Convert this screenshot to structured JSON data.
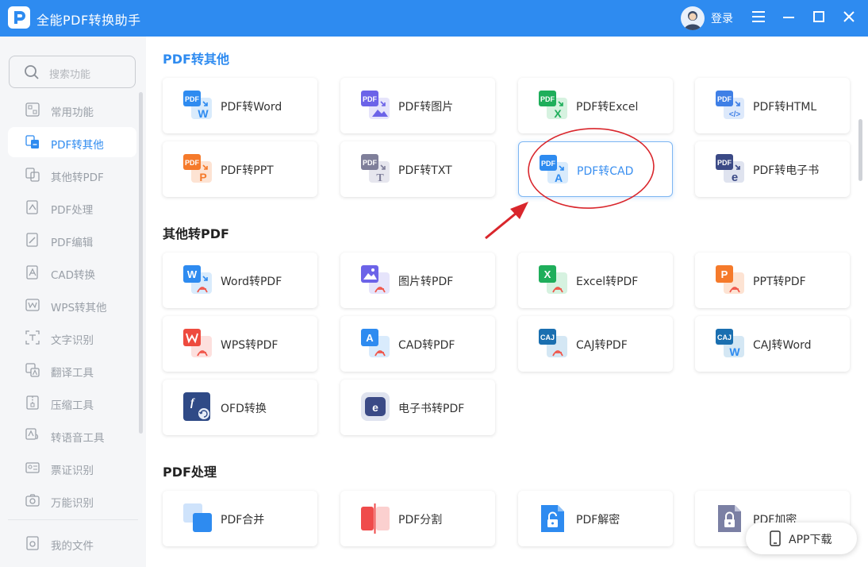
{
  "titlebar": {
    "app_title": "全能PDF转换助手",
    "login_label": "登录",
    "accent": "#2e8bf0"
  },
  "sidebar": {
    "search_placeholder": "搜索功能",
    "items": [
      {
        "label": "常用功能",
        "icon": "grid-icon",
        "active": false
      },
      {
        "label": "PDF转其他",
        "icon": "pdf-export-icon",
        "active": true
      },
      {
        "label": "其他转PDF",
        "icon": "pdf-import-icon",
        "active": false
      },
      {
        "label": "PDF处理",
        "icon": "pdf-process-icon",
        "active": false
      },
      {
        "label": "PDF编辑",
        "icon": "pdf-edit-icon",
        "active": false
      },
      {
        "label": "CAD转换",
        "icon": "cad-icon",
        "active": false
      },
      {
        "label": "WPS转其他",
        "icon": "wps-icon",
        "active": false
      },
      {
        "label": "文字识别",
        "icon": "ocr-icon",
        "active": false
      },
      {
        "label": "翻译工具",
        "icon": "translate-icon",
        "active": false
      },
      {
        "label": "压缩工具",
        "icon": "compress-icon",
        "active": false
      },
      {
        "label": "转语音工具",
        "icon": "speech-icon",
        "active": false
      },
      {
        "label": "票证识别",
        "icon": "ticket-icon",
        "active": false
      },
      {
        "label": "万能识别",
        "icon": "camera-icon",
        "active": false
      }
    ],
    "my_files": "我的文件"
  },
  "sections": {
    "pdf_to_other": {
      "title": "PDF转其他",
      "cards": [
        "PDF转Word",
        "PDF转图片",
        "PDF转Excel",
        "PDF转HTML",
        "PDF转PPT",
        "PDF转TXT",
        "PDF转CAD",
        "PDF转电子书"
      ]
    },
    "other_to_pdf": {
      "title": "其他转PDF",
      "cards": [
        "Word转PDF",
        "图片转PDF",
        "Excel转PDF",
        "PPT转PDF",
        "WPS转PDF",
        "CAD转PDF",
        "CAJ转PDF",
        "CAJ转Word",
        "OFD转换",
        "电子书转PDF"
      ]
    },
    "pdf_process": {
      "title": "PDF处理",
      "cards": [
        "PDF合并",
        "PDF分割",
        "PDF解密",
        "PDF加密"
      ]
    }
  },
  "icon_text": {
    "pdf": "PDF",
    "w": "W",
    "p": "P",
    "a": "A",
    "t": "T",
    "e": "e",
    "x": "X",
    "caj": "CAJ",
    "code": "</>"
  },
  "app_download": "APP下载"
}
